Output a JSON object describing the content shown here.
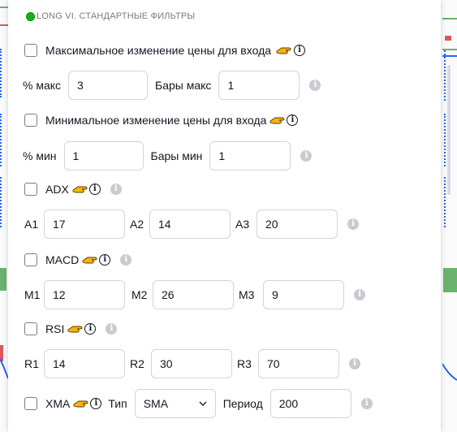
{
  "section": {
    "title": "LONG VI. СТАНДАРТНЫЕ ФИЛЬТРЫ",
    "status_color": "#12b312"
  },
  "max_change": {
    "label": "Максимальное изменение цены для входа",
    "pct_label": "% макс",
    "pct_value": "3",
    "bars_label": "Бары макс",
    "bars_value": "1"
  },
  "min_change": {
    "label": "Минимальное изменение цены для входа",
    "pct_label": "% мин",
    "pct_value": "1",
    "bars_label": "Бары мин",
    "bars_value": "1"
  },
  "adx": {
    "label": "ADX",
    "fields": [
      {
        "label": "A1",
        "value": "17"
      },
      {
        "label": "A2",
        "value": "14"
      },
      {
        "label": "A3",
        "value": "20"
      }
    ]
  },
  "macd": {
    "label": "MACD",
    "fields": [
      {
        "label": "M1",
        "value": "12"
      },
      {
        "label": "M2",
        "value": "26"
      },
      {
        "label": "M3",
        "value": "9"
      }
    ]
  },
  "rsi": {
    "label": "RSI",
    "fields": [
      {
        "label": "R1",
        "value": "14"
      },
      {
        "label": "R2",
        "value": "30"
      },
      {
        "label": "R3",
        "value": "70"
      }
    ]
  },
  "xma": {
    "label": "XMA",
    "type_label": "Тип",
    "type_value": "SMA",
    "period_label": "Период",
    "period_value": "200"
  },
  "icons": {
    "hand": "pointing-hand-icon",
    "info_outline": "info-circle-icon",
    "info_gray": "info-gray-icon",
    "chevron": "chevron-down-icon"
  }
}
